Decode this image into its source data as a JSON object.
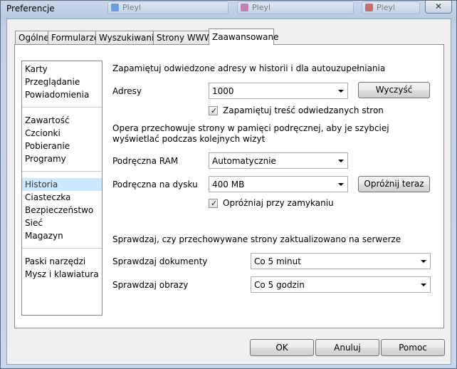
{
  "window": {
    "title": "Preferencje",
    "background_tabs": [
      "Pleyl",
      "Pleyl",
      "Pleyl"
    ],
    "close_symbol": "✕"
  },
  "tabs": [
    {
      "label": "Ogólne"
    },
    {
      "label": "Formularze"
    },
    {
      "label": "Wyszukiwanie"
    },
    {
      "label": "Strony WWW"
    },
    {
      "label": "Zaawansowane",
      "active": true
    }
  ],
  "nav": {
    "group1": [
      "Karty",
      "Przeglądanie",
      "Powiadomienia"
    ],
    "group2": [
      "Zawartość",
      "Czcionki",
      "Pobieranie",
      "Programy"
    ],
    "group3": [
      "Historia",
      "Ciasteczka",
      "Bezpieczeństwo",
      "Sieć",
      "Magazyn"
    ],
    "group4": [
      "Paski narzędzi",
      "Mysz i klawiatura"
    ],
    "selected": "Historia"
  },
  "history": {
    "heading": "Zapamiętuj odwiedzone adresy w historii i dla autouzupełniania",
    "addresses_label": "Adresy",
    "addresses_value": "1000",
    "clear_button": "Wyczyść",
    "remember_content_label": "Zapamiętuj treść odwiedzanych stron",
    "remember_content_checked": true
  },
  "cache": {
    "description_line1": "Opera przechowuje strony w pamięci podręcznej, aby je szybciej",
    "description_line2": "wyświetlać podczas kolejnych wizyt",
    "ram_label": "Podręczna RAM",
    "ram_value": "Automatycznie",
    "disk_label": "Podręczna na dysku",
    "disk_value": "400 MB",
    "empty_now_button": "Opróżnij teraz",
    "empty_on_exit_label": "Opróżniaj przy zamykaniu",
    "empty_on_exit_checked": true
  },
  "check": {
    "heading": "Sprawdzaj, czy przechowywane strony zaktualizowano na serwerze",
    "documents_label": "Sprawdzaj dokumenty",
    "documents_value": "Co 5 minut",
    "images_label": "Sprawdzaj obrazy",
    "images_value": "Co 5 godzin"
  },
  "footer": {
    "ok": "OK",
    "cancel": "Anuluj",
    "help": "Pomoc"
  },
  "colors": {
    "selected_nav": "#cce8ff",
    "window_frame": "#c3d3e6"
  }
}
